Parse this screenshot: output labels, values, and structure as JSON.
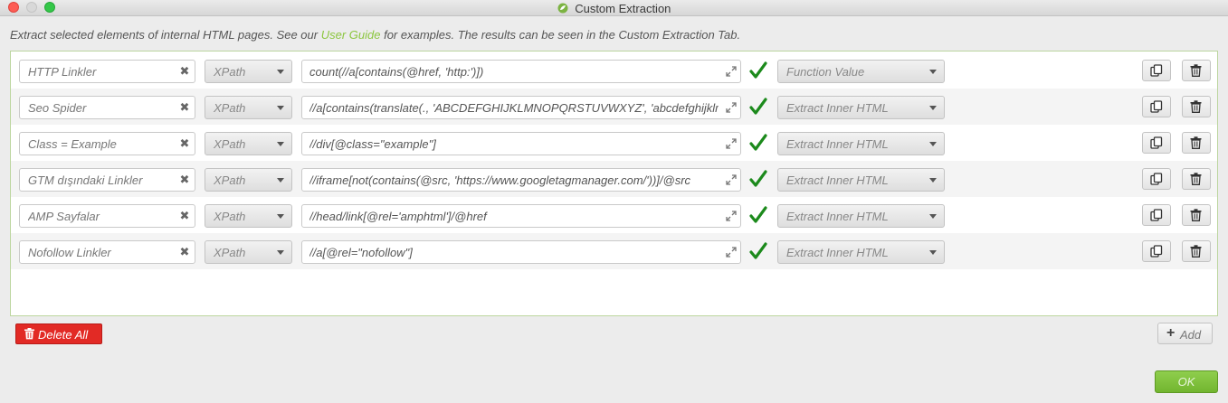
{
  "window": {
    "title": "Custom Extraction"
  },
  "intro": {
    "before": "Extract selected elements of internal HTML pages. See our ",
    "link": "User Guide",
    "after": " for examples. The results can be seen in the Custom Extraction Tab."
  },
  "extractors": [
    {
      "name": "HTTP Linkler",
      "type": "XPath",
      "expression": "count(//a[contains(@href, 'http:')])",
      "mode": "Function Value"
    },
    {
      "name": "Seo Spider",
      "type": "XPath",
      "expression": "//a[contains(translate(., 'ABCDEFGHIJKLMNOPQRSTUVWXYZ', 'abcdefghijklmnopqrstuvwxyz'), 'seo spider')]",
      "mode": "Extract Inner HTML"
    },
    {
      "name": "Class = Example",
      "type": "XPath",
      "expression": "//div[@class=\"example\"]",
      "mode": "Extract Inner HTML"
    },
    {
      "name": "GTM dışındaki Linkler",
      "type": "XPath",
      "expression": "//iframe[not(contains(@src, 'https://www.googletagmanager.com/'))]/@src",
      "mode": "Extract Inner HTML"
    },
    {
      "name": "AMP Sayfalar",
      "type": "XPath",
      "expression": "//head/link[@rel='amphtml']/@href",
      "mode": "Extract Inner HTML"
    },
    {
      "name": "Nofollow Linkler",
      "type": "XPath",
      "expression": "//a[@rel=\"nofollow\"]",
      "mode": "Extract Inner HTML"
    }
  ],
  "buttons": {
    "delete_all": "Delete All",
    "add": "Add",
    "ok": "OK"
  },
  "colors": {
    "accent_green": "#8cc63f",
    "valid_check": "#1c8a1c",
    "danger_red": "#e22a25"
  },
  "icons": {
    "valid": "check-icon",
    "clear": "x-icon",
    "expand": "expand-icon",
    "duplicate": "copy-icon",
    "remove": "trash-icon"
  }
}
